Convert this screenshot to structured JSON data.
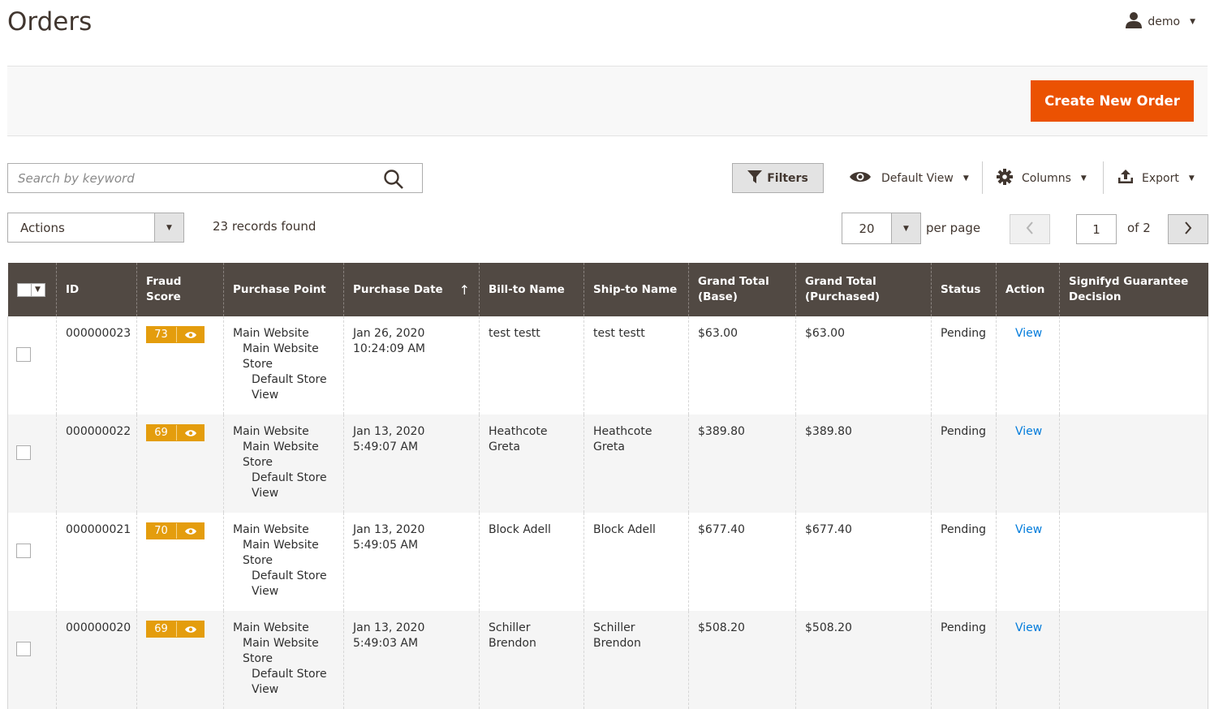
{
  "header": {
    "title": "Orders",
    "user": "demo"
  },
  "actions_bar": {
    "create_button": "Create New Order"
  },
  "toolbar": {
    "search_placeholder": "Search by keyword",
    "filters": "Filters",
    "view": "Default View",
    "columns": "Columns",
    "export": "Export"
  },
  "mass_actions": {
    "label": "Actions",
    "records_found": "23 records found"
  },
  "pagination": {
    "per_page_value": "20",
    "per_page_label": "per page",
    "current_page": "1",
    "total_label": "of 2"
  },
  "grid": {
    "headers": {
      "id": "ID",
      "fraud_score": "Fraud Score",
      "purchase_point": "Purchase Point",
      "purchase_date": "Purchase Date",
      "bill_to": "Bill-to Name",
      "ship_to": "Ship-to Name",
      "grand_total_base": "Grand Total (Base)",
      "grand_total_purchased": "Grand Total (Purchased)",
      "status": "Status",
      "action": "Action",
      "signifyd": "Signifyd Guarantee Decision"
    },
    "sort_indicator": "↑",
    "rows": [
      {
        "id": "000000023",
        "fraud_score": "73",
        "pp_website": "Main Website",
        "pp_store": "Main Website Store",
        "pp_view": "Default Store View",
        "date": "Jan 26, 2020 10:24:09 AM",
        "bill_to": "test testt",
        "ship_to": "test testt",
        "total_base": "$63.00",
        "total_purchased": "$63.00",
        "status": "Pending",
        "action": "View"
      },
      {
        "id": "000000022",
        "fraud_score": "69",
        "pp_website": "Main Website",
        "pp_store": "Main Website Store",
        "pp_view": "Default Store View",
        "date": "Jan 13, 2020 5:49:07 AM",
        "bill_to": "Heathcote Greta",
        "ship_to": "Heathcote Greta",
        "total_base": "$389.80",
        "total_purchased": "$389.80",
        "status": "Pending",
        "action": "View"
      },
      {
        "id": "000000021",
        "fraud_score": "70",
        "pp_website": "Main Website",
        "pp_store": "Main Website Store",
        "pp_view": "Default Store View",
        "date": "Jan 13, 2020 5:49:05 AM",
        "bill_to": "Block Adell",
        "ship_to": "Block Adell",
        "total_base": "$677.40",
        "total_purchased": "$677.40",
        "status": "Pending",
        "action": "View"
      },
      {
        "id": "000000020",
        "fraud_score": "69",
        "pp_website": "Main Website",
        "pp_store": "Main Website Store",
        "pp_view": "Default Store View",
        "date": "Jan 13, 2020 5:49:03 AM",
        "bill_to": "Schiller Brendon",
        "ship_to": "Schiller Brendon",
        "total_base": "$508.20",
        "total_purchased": "$508.20",
        "status": "Pending",
        "action": "View"
      }
    ]
  },
  "colors": {
    "accent": "#eb5202",
    "header_bg": "#514943",
    "badge": "#e49d0d",
    "link": "#007bdb"
  }
}
